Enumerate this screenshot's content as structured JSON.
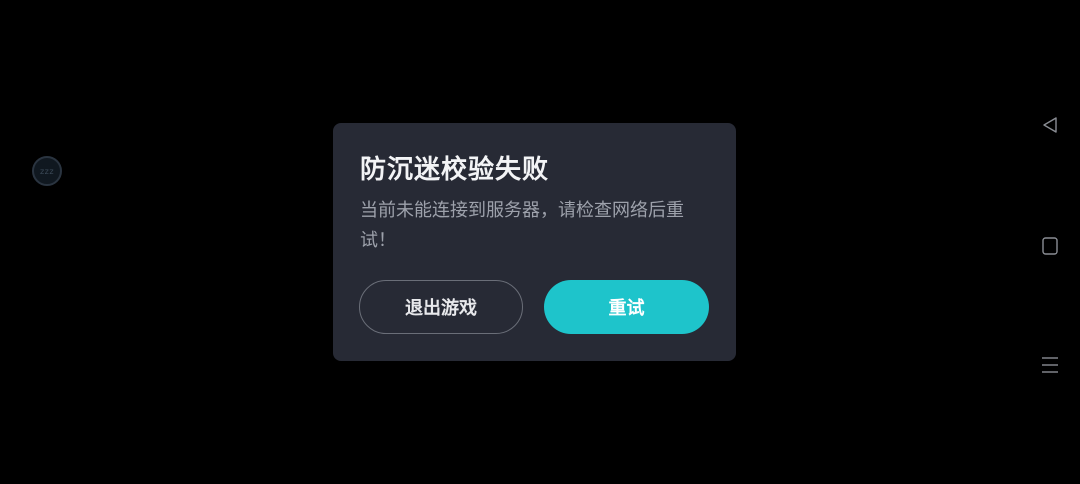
{
  "floating_badge": {
    "text": "zzz",
    "icon": "assistive-touch-icon"
  },
  "dialog": {
    "title": "防沉迷校验失败",
    "message": "当前未能连接到服务器，请检查网络后重试！",
    "buttons": {
      "exit_label": "退出游戏",
      "retry_label": "重试"
    },
    "colors": {
      "background": "#272a35",
      "accent": "#1ec4cb",
      "title": "#f3f4f6",
      "message": "#9da1ab"
    }
  },
  "navigation_bar": {
    "icons": [
      "back-icon",
      "home-icon",
      "menu-icon"
    ]
  }
}
